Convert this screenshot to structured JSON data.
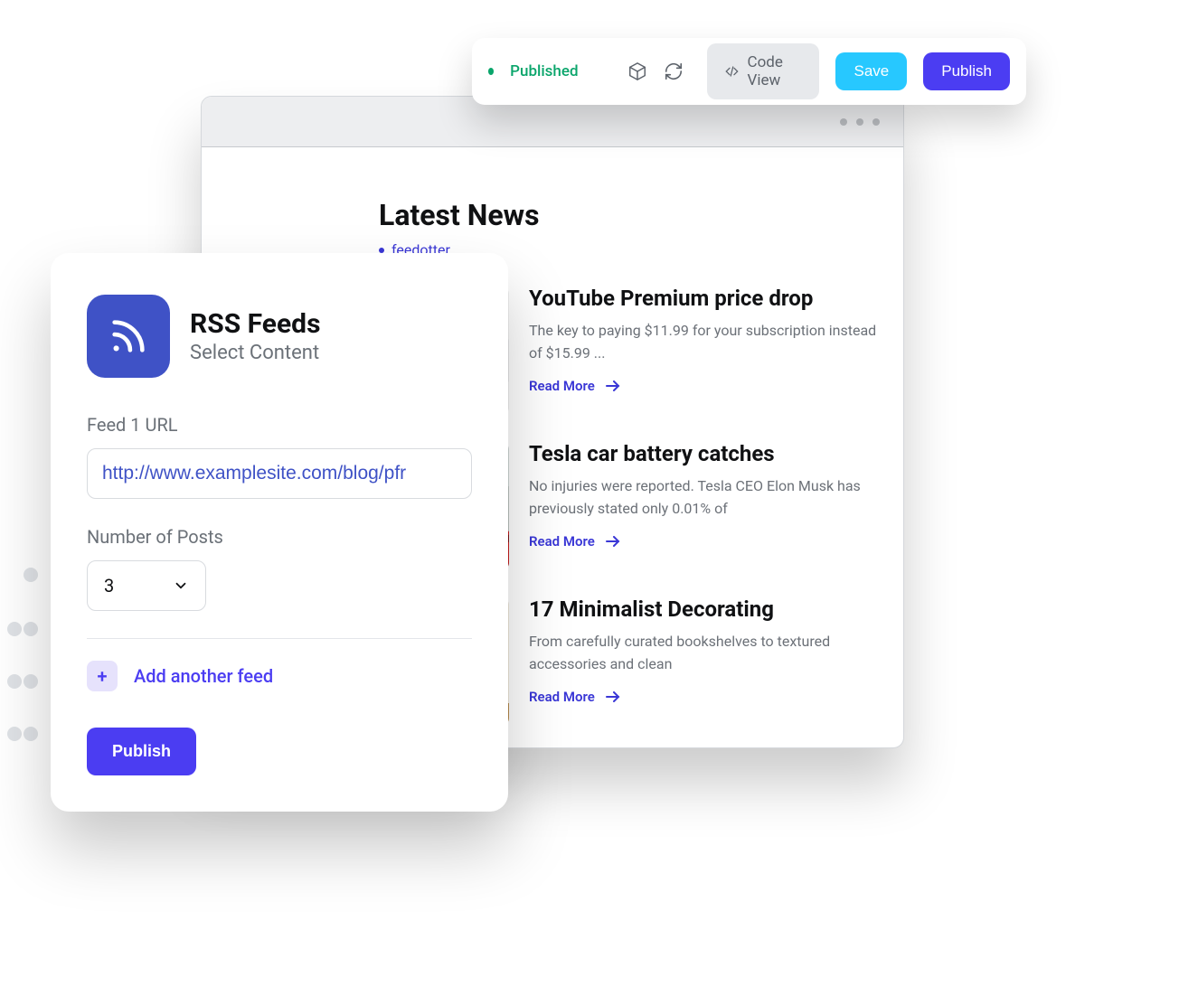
{
  "toolbar": {
    "status": "Published",
    "code_view_label": "Code View",
    "save_label": "Save",
    "publish_label": "Publish"
  },
  "preview": {
    "section_title": "Latest News",
    "tag": "feedotter",
    "read_more_label": "Read More",
    "items": [
      {
        "title": "YouTube Premium price drop",
        "excerpt": "The key to paying $11.99 for your subscription instead of $15.99 ..."
      },
      {
        "title": "Tesla car battery catches",
        "excerpt": "No injuries were reported. Tesla CEO Elon Musk has previously stated only 0.01% of"
      },
      {
        "title": "17 Minimalist Decorating",
        "excerpt": "From carefully curated bookshelves to textured accessories and clean"
      }
    ]
  },
  "panel": {
    "title": "RSS Feeds",
    "subtitle": "Select Content",
    "feed_url_label": "Feed 1 URL",
    "feed_url_value": "http://www.examplesite.com/blog/pfr",
    "num_posts_label": "Number of Posts",
    "num_posts_value": "3",
    "add_feed_label": "Add another feed",
    "publish_label": "Publish"
  },
  "colors": {
    "accent_purple": "#4b3df2",
    "accent_blue": "#3f52c6",
    "save_cyan": "#27c8ff",
    "status_green": "#0aa56b"
  }
}
